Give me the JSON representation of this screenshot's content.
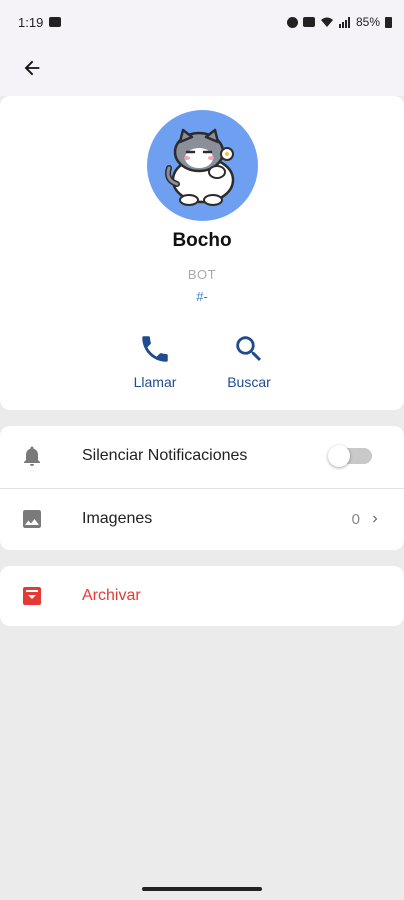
{
  "status_bar": {
    "time": "1:19",
    "battery": "85%"
  },
  "contact": {
    "name": "Bocho",
    "type": "BOT",
    "tag": "#-"
  },
  "actions": {
    "call_label": "Llamar",
    "search_label": "Buscar"
  },
  "settings": {
    "mute_label": "Silenciar Notificaciones",
    "mute_enabled": false,
    "images_label": "Imagenes",
    "images_count": "0"
  },
  "archive": {
    "label": "Archivar"
  },
  "colors": {
    "accent": "#1f4b8f",
    "danger": "#e53935",
    "avatar_bg": "#6f9ff0"
  }
}
